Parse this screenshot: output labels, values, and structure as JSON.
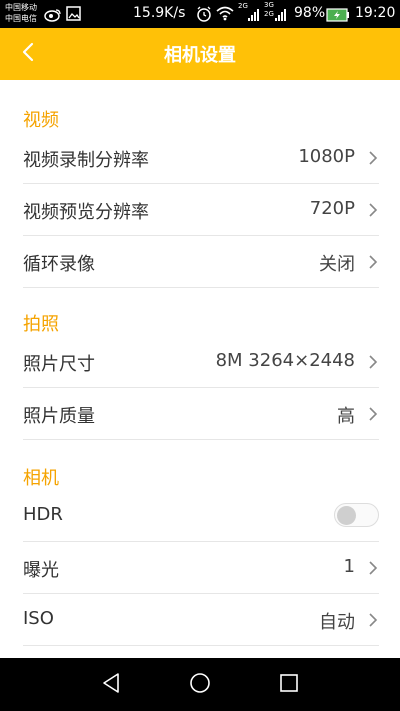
{
  "status_bar": {
    "carrier_line1": "中国移动",
    "carrier_line2": "中国电信",
    "net_speed": "15.9K/s",
    "signal1_label": "2G",
    "signal2_label_top": "3G",
    "signal2_label_bottom": "2G",
    "battery": "98%",
    "time": "19:20"
  },
  "header": {
    "title": "相机设置"
  },
  "sections": {
    "video": {
      "title": "视频",
      "items": [
        {
          "label": "视频录制分辨率",
          "value": "1080P"
        },
        {
          "label": "视频预览分辨率",
          "value": "720P"
        },
        {
          "label": "循环录像",
          "value": "关闭"
        }
      ]
    },
    "photo": {
      "title": "拍照",
      "items": [
        {
          "label": "照片尺寸",
          "value": "8M 3264×2448"
        },
        {
          "label": "照片质量",
          "value": "高"
        }
      ]
    },
    "camera": {
      "title": "相机",
      "items": [
        {
          "label": "HDR",
          "value": ""
        },
        {
          "label": "曝光",
          "value": "1"
        },
        {
          "label": "ISO",
          "value": "自动"
        }
      ],
      "hdr_enabled": false
    }
  },
  "colors": {
    "accent": "#FFC107",
    "section_title": "#F5A300"
  },
  "icons": {
    "back": "chevron-left-icon",
    "row_arrow": "chevron-right-icon",
    "nav_back": "triangle-back-icon",
    "nav_home": "circle-home-icon",
    "nav_recent": "square-recent-icon"
  }
}
